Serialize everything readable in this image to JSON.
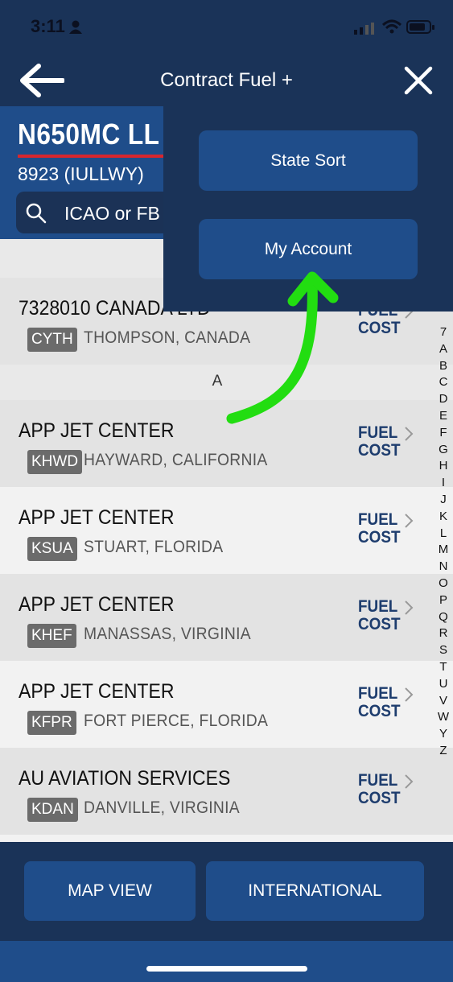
{
  "status_bar": {
    "time": "3:11"
  },
  "nav": {
    "title": "Contract Fuel +"
  },
  "header": {
    "tail_number": "N650MC LL",
    "account": "8923 (IULLWY)",
    "search_placeholder": "ICAO or FB"
  },
  "list": {
    "rows_top": [
      {
        "name": "7328010 CANADA LTD",
        "code": "CYTH",
        "location": "THOMPSON, CANADA",
        "fuel_line1": "FUEL",
        "fuel_line2": "COST"
      }
    ],
    "section_a": "A",
    "rows_a": [
      {
        "name": "APP JET CENTER",
        "code": "KHWD",
        "location": "HAYWARD, CALIFORNIA",
        "fuel_line1": "FUEL",
        "fuel_line2": "COST"
      },
      {
        "name": "APP JET CENTER",
        "code": "KSUA",
        "location": "STUART, FLORIDA",
        "fuel_line1": "FUEL",
        "fuel_line2": "COST"
      },
      {
        "name": "APP JET CENTER",
        "code": "KHEF",
        "location": "MANASSAS, VIRGINIA",
        "fuel_line1": "FUEL",
        "fuel_line2": "COST"
      },
      {
        "name": "APP JET CENTER",
        "code": "KFPR",
        "location": "FORT PIERCE, FLORIDA",
        "fuel_line1": "FUEL",
        "fuel_line2": "COST"
      },
      {
        "name": "AU AVIATION SERVICES",
        "code": "KDAN",
        "location": "DANVILLE, VIRGINIA",
        "fuel_line1": "FUEL",
        "fuel_line2": "COST"
      }
    ]
  },
  "alpha_index": [
    "7",
    "A",
    "B",
    "C",
    "D",
    "E",
    "F",
    "G",
    "H",
    "I",
    "J",
    "K",
    "L",
    "M",
    "N",
    "O",
    "P",
    "Q",
    "R",
    "S",
    "T",
    "U",
    "V",
    "W",
    "Y",
    "Z"
  ],
  "bottom": {
    "map_view": "MAP VIEW",
    "international": "INTERNATIONAL"
  },
  "menu": {
    "state_sort": "State Sort",
    "my_account": "My Account"
  },
  "colors": {
    "navy": "#1a3358",
    "blue": "#1f4d8a",
    "accent_red": "#d7262e",
    "arrow_green": "#22dd11"
  }
}
